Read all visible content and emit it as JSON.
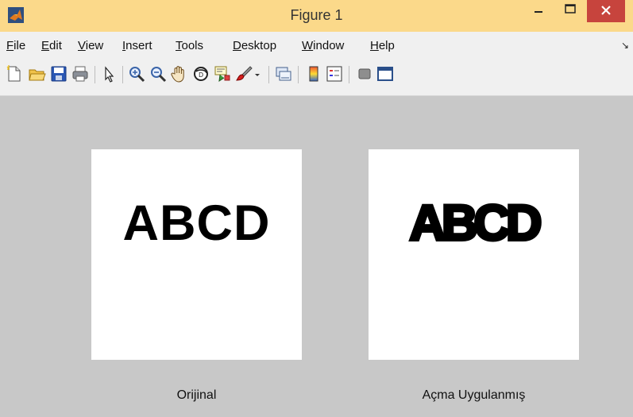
{
  "window": {
    "title": "Figure 1",
    "controls": {
      "minimize": "–",
      "maximize": "☐",
      "close": "✕"
    },
    "titlebar_color": "#fbd98a",
    "close_color": "#c7443d"
  },
  "menu": {
    "items": [
      {
        "key": "F",
        "rest": "ile"
      },
      {
        "key": "E",
        "rest": "dit"
      },
      {
        "key": "V",
        "rest": "iew"
      },
      {
        "key": "I",
        "rest": "nsert"
      },
      {
        "key": "T",
        "rest": "ools"
      },
      {
        "key": "D",
        "rest": "esktop"
      },
      {
        "key": "W",
        "rest": "indow"
      },
      {
        "key": "H",
        "rest": "elp"
      }
    ],
    "overflow_arrow": "↘"
  },
  "toolbar": {
    "buttons": [
      "new-figure-icon",
      "open-file-icon",
      "save-icon",
      "print-icon",
      "edit-plot-arrow-icon",
      "zoom-in-icon",
      "zoom-out-icon",
      "pan-hand-icon",
      "rotate-3d-icon",
      "data-cursor-icon",
      "brush-icon",
      "brush-dropdown-icon",
      "link-plot-icon",
      "colorbar-icon",
      "legend-icon",
      "hide-plot-tools-icon",
      "show-plot-tools-icon"
    ]
  },
  "figure": {
    "background": "#c8c8c8",
    "axes": [
      {
        "image_text": "ABCD",
        "caption": "Orijinal"
      },
      {
        "image_text": "ABCD",
        "caption": "Açma Uygulanmış"
      }
    ]
  }
}
